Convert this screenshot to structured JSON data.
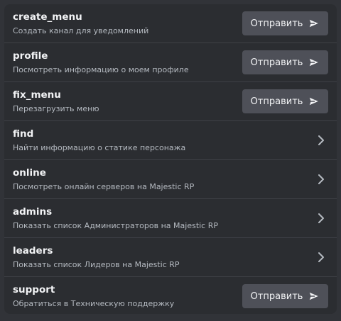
{
  "commands": [
    {
      "name": "create_menu",
      "description": "Создать канал для уведомлений",
      "action": "button",
      "button_label": "Отправить",
      "icon": "send-icon"
    },
    {
      "name": "profile",
      "description": "Посмотреть информацию о моем профиле",
      "action": "button",
      "button_label": "Отправить",
      "icon": "send-icon"
    },
    {
      "name": "fix_menu",
      "description": "Перезагрузить меню",
      "action": "button",
      "button_label": "Отправить",
      "icon": "send-icon"
    },
    {
      "name": "find",
      "description": "Найти информацию о статике персонажа",
      "action": "chevron",
      "icon": "chevron-right-icon"
    },
    {
      "name": "online",
      "description": "Посмотреть онлайн серверов на Majestic RP",
      "action": "chevron",
      "icon": "chevron-right-icon"
    },
    {
      "name": "admins",
      "description": "Показать список Администраторов на Majestic RP",
      "action": "chevron",
      "icon": "chevron-right-icon"
    },
    {
      "name": "leaders",
      "description": "Показать список Лидеров на Majestic RP",
      "action": "chevron",
      "icon": "chevron-right-icon"
    },
    {
      "name": "support",
      "description": "Обратиться в Техническую поддержку",
      "action": "button",
      "button_label": "Отправить",
      "icon": "send-icon"
    }
  ],
  "colors": {
    "background": "#313338",
    "panel": "#2b2d31",
    "button": "#4e5058",
    "text_primary": "#f2f3f5",
    "text_secondary": "#b5bac1"
  }
}
